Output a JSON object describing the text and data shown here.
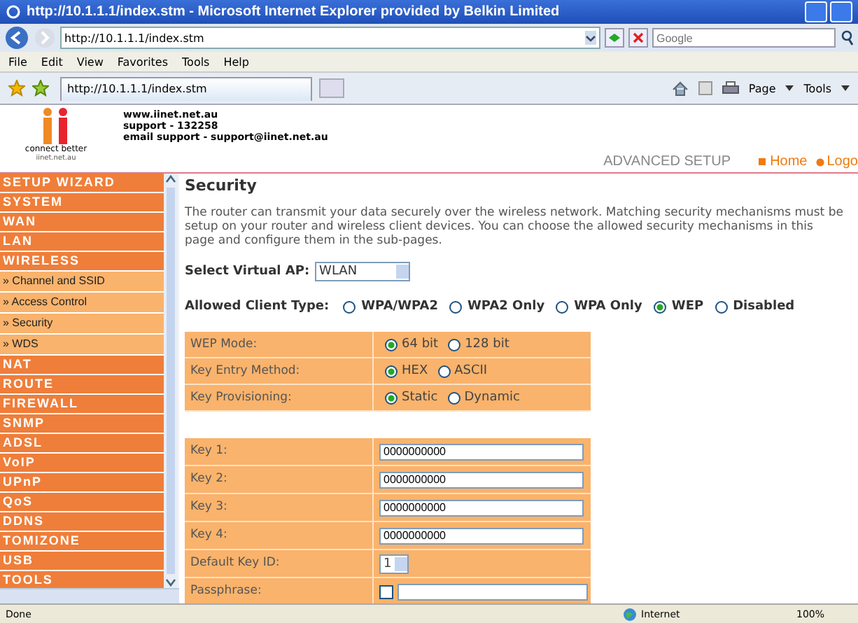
{
  "window": {
    "title": "http://10.1.1.1/index.stm - Microsoft Internet Explorer provided by Belkin Limited"
  },
  "address_bar": {
    "url": "http://10.1.1.1/index.stm",
    "search_placeholder": "Google"
  },
  "menu": [
    "File",
    "Edit",
    "View",
    "Favorites",
    "Tools",
    "Help"
  ],
  "tabs": [
    {
      "label": "http://10.1.1.1/index.stm",
      "selected": true
    }
  ],
  "command_bar": [
    "Page",
    "Tools"
  ],
  "header": {
    "logo_caption": "connect better",
    "logo_domain": "iinet.net.au",
    "contact": [
      "www.iinet.net.au",
      "support - 132258",
      "email support - support@iinet.net.au"
    ],
    "section": "ADVANCED SETUP",
    "links": [
      "Home",
      "Logo"
    ]
  },
  "sidebar": {
    "items": [
      {
        "label": "SETUP WIZARD",
        "kind": "section"
      },
      {
        "label": "SYSTEM",
        "kind": "section"
      },
      {
        "label": "WAN",
        "kind": "section"
      },
      {
        "label": "LAN",
        "kind": "section"
      },
      {
        "label": "WIRELESS",
        "kind": "section"
      },
      {
        "label": "» Channel and SSID",
        "kind": "sub"
      },
      {
        "label": "» Access Control",
        "kind": "sub"
      },
      {
        "label": "» Security",
        "kind": "sub"
      },
      {
        "label": "» WDS",
        "kind": "sub"
      },
      {
        "label": "NAT",
        "kind": "section"
      },
      {
        "label": "ROUTE",
        "kind": "section"
      },
      {
        "label": "FIREWALL",
        "kind": "section"
      },
      {
        "label": "SNMP",
        "kind": "section"
      },
      {
        "label": "ADSL",
        "kind": "section"
      },
      {
        "label": "VoIP",
        "kind": "section"
      },
      {
        "label": "UPnP",
        "kind": "section"
      },
      {
        "label": "QoS",
        "kind": "section"
      },
      {
        "label": "DDNS",
        "kind": "section"
      },
      {
        "label": "TOMIZONE",
        "kind": "section"
      },
      {
        "label": "USB",
        "kind": "section"
      },
      {
        "label": "TOOLS",
        "kind": "section"
      }
    ]
  },
  "content": {
    "title": "Security",
    "description": "The router can transmit your data securely over the wireless network. Matching security mechanisms must be setup on your router and wireless client devices. You can choose the allowed security mechanisms in this page and configure them in the sub-pages.",
    "virtual_ap": {
      "label": "Select Virtual AP:",
      "value": "WLAN"
    },
    "client_type": {
      "label": "Allowed Client Type:",
      "options": [
        {
          "label": "WPA/WPA2",
          "selected": false
        },
        {
          "label": "WPA2 Only",
          "selected": false
        },
        {
          "label": "WPA Only",
          "selected": false
        },
        {
          "label": "WEP",
          "selected": true
        },
        {
          "label": "Disabled",
          "selected": false
        }
      ]
    },
    "wep_rows": [
      {
        "label": "WEP Mode:",
        "options": [
          {
            "label": "64 bit",
            "selected": true
          },
          {
            "label": "128 bit",
            "selected": false
          }
        ]
      },
      {
        "label": "Key Entry Method:",
        "options": [
          {
            "label": "HEX",
            "selected": true
          },
          {
            "label": "ASCII",
            "selected": false
          }
        ]
      },
      {
        "label": "Key Provisioning:",
        "options": [
          {
            "label": "Static",
            "selected": true
          },
          {
            "label": "Dynamic",
            "selected": false
          }
        ]
      }
    ],
    "key_rows": [
      {
        "kind": "text",
        "label": "Key 1:",
        "value": "0000000000"
      },
      {
        "kind": "text",
        "label": "Key 2:",
        "value": "0000000000"
      },
      {
        "kind": "text",
        "label": "Key 3:",
        "value": "0000000000"
      },
      {
        "kind": "text",
        "label": "Key 4:",
        "value": "0000000000"
      },
      {
        "kind": "select",
        "label": "Default Key ID:",
        "value": "1"
      },
      {
        "kind": "checkbox",
        "label": "Passphrase:",
        "checked": false
      }
    ]
  },
  "status_bar": {
    "text": "Done",
    "zone": "Internet",
    "zoom": "100%"
  }
}
